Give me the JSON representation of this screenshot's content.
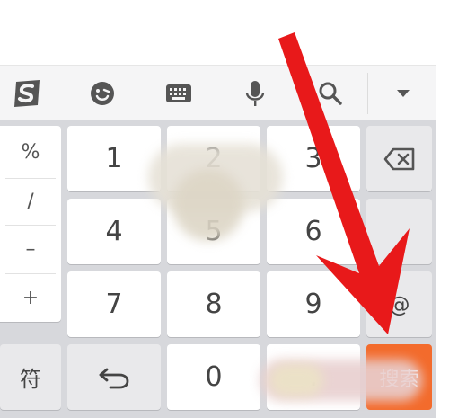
{
  "toolbar": {
    "icons": [
      "sogou-logo-icon",
      "emoji-icon",
      "keyboard-icon",
      "microphone-icon",
      "search-icon",
      "collapse-icon"
    ]
  },
  "symbols": {
    "items": [
      "%",
      "/",
      "–",
      "+"
    ]
  },
  "keys": {
    "k1": "1",
    "k2": "2",
    "k3": "3",
    "k4": "4",
    "k5": "5",
    "k6": "6",
    "k7": "7",
    "k8": "8",
    "k9": "9",
    "k0": "0",
    "at": "@",
    "dot": ".",
    "symbol_label": "符",
    "search_label": "搜索"
  },
  "colors": {
    "accent": "#f36b2c",
    "arrow": "#e8191a"
  }
}
